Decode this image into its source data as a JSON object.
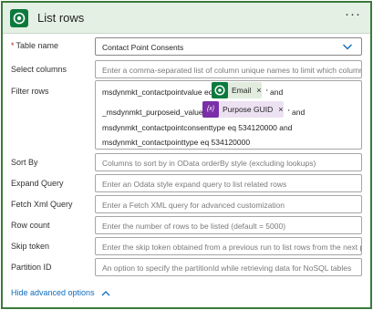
{
  "header": {
    "title": "List rows",
    "more": "···"
  },
  "table_name": {
    "label": "Table name",
    "required_mark": "*",
    "value": "Contact Point Consents"
  },
  "select_columns": {
    "label": "Select columns",
    "placeholder": "Enter a comma-separated list of column unique names to limit which columns a"
  },
  "filter_rows": {
    "label": "Filter rows",
    "line1_prefix": "msdynmkt_contactpointvalue eq '",
    "token_email": "Email",
    "line1_suffix": "' and",
    "line2_prefix": "_msdynmkt_purposeid_value eq '",
    "token_purpose": "Purpose GUID",
    "token_purpose_icon": "{x}",
    "line2_suffix": "' and",
    "line3": "msdynmkt_contactpointconsenttype eq 534120000 and",
    "line4": "msdynmkt_contactpointtype eq 534120000",
    "token_close": "×"
  },
  "sort_by": {
    "label": "Sort By",
    "placeholder": "Columns to sort by in OData orderBy style (excluding lookups)"
  },
  "expand_query": {
    "label": "Expand Query",
    "placeholder": "Enter an Odata style expand query to list related rows"
  },
  "fetch_xml": {
    "label": "Fetch Xml Query",
    "placeholder": "Enter a Fetch XML query for advanced customization"
  },
  "row_count": {
    "label": "Row count",
    "placeholder": "Enter the number of rows to be listed (default = 5000)"
  },
  "skip_token": {
    "label": "Skip token",
    "placeholder": "Enter the skip token obtained from a previous run to list rows from the next pa"
  },
  "partition_id": {
    "label": "Partition ID",
    "placeholder": "An option to specify the partitionId while retrieving data for NoSQL tables"
  },
  "advanced": {
    "label": "Hide advanced options"
  },
  "colors": {
    "accent": "#0b7a3d",
    "link": "#0f6cbd",
    "purple": "#7a2fa8",
    "header_bg": "#e4f0e4"
  },
  "icons": {
    "logo": "dataverse-icon",
    "dropdown": "chevron-down-icon",
    "advanced": "chevron-up-icon"
  }
}
